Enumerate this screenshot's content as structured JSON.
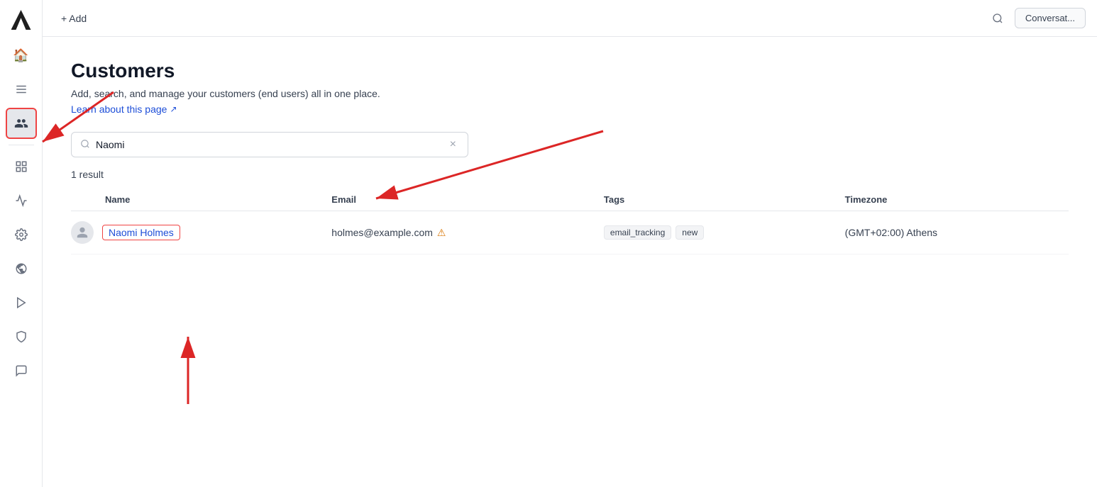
{
  "logo": {
    "alt": "Kustomer logo"
  },
  "topbar": {
    "add_label": "+ Add",
    "search_placeholder": "Search",
    "convo_button": "Conversat..."
  },
  "sidebar": {
    "items": [
      {
        "id": "home",
        "icon": "🏠",
        "label": "Home",
        "active": false
      },
      {
        "id": "lists",
        "icon": "☰",
        "label": "Lists",
        "active": false
      },
      {
        "id": "customers",
        "icon": "👥",
        "label": "Customers",
        "active": true
      },
      {
        "id": "reports",
        "icon": "⊞",
        "label": "Reports",
        "active": false
      },
      {
        "id": "analytics",
        "icon": "📊",
        "label": "Analytics",
        "active": false
      },
      {
        "id": "settings",
        "icon": "⚙",
        "label": "Settings",
        "active": false
      },
      {
        "id": "integrations",
        "icon": "◑",
        "label": "Integrations",
        "active": false
      },
      {
        "id": "media",
        "icon": "▷",
        "label": "Media",
        "active": false
      },
      {
        "id": "security",
        "icon": "🛡",
        "label": "Security",
        "active": false
      },
      {
        "id": "feedback",
        "icon": "💬",
        "label": "Feedback",
        "active": false
      }
    ]
  },
  "page": {
    "title": "Customers",
    "description": "Add, search, and manage your customers (end users) all in one place.",
    "learn_link": "Learn about this page",
    "learn_link_icon": "↗"
  },
  "search": {
    "placeholder": "Search",
    "value": "Naomi",
    "clear_label": "×"
  },
  "results": {
    "count_text": "1 result"
  },
  "table": {
    "columns": [
      "Name",
      "Email",
      "Tags",
      "Timezone"
    ],
    "rows": [
      {
        "name": "Naomi Holmes",
        "email": "holmes@example.com",
        "has_warning": true,
        "tags": [
          "email_tracking",
          "new"
        ],
        "timezone": "(GMT+02:00) Athens"
      }
    ]
  }
}
